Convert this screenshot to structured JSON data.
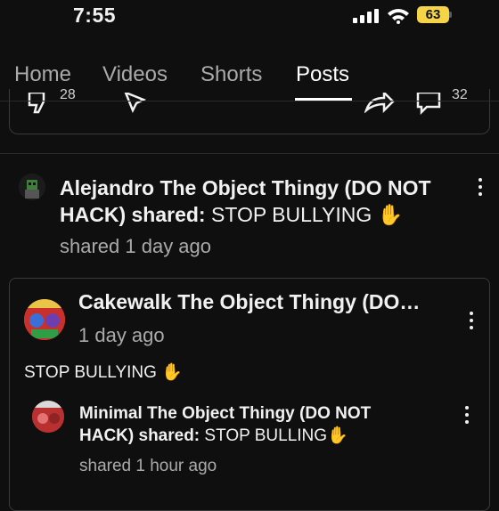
{
  "status_bar": {
    "time": "7:55",
    "battery": "63"
  },
  "tabs": [
    {
      "label": "Home",
      "active": false
    },
    {
      "label": "Videos",
      "active": false
    },
    {
      "label": "Shorts",
      "active": false
    },
    {
      "label": "Posts",
      "active": true
    }
  ],
  "previous_post": {
    "like_count": "28",
    "comment_count": "32"
  },
  "shared_post": {
    "author": "Alejandro The Object Thingy (DO NOT HACK)",
    "action": "shared:",
    "title": "STOP BULLYING ✋",
    "time": "shared 1 day ago"
  },
  "original_post": {
    "channel_name": "Cakewalk The Object Thingy (DO…",
    "time": "1 day ago",
    "text": "STOP BULLYING ✋",
    "nested": {
      "author": "Minimal The Object Thingy (DO NOT HACK)",
      "action": "shared:",
      "title": "STOP BULLING✋",
      "time": "shared 1 hour ago"
    }
  },
  "colors": {
    "background": "#0f0f0f",
    "battery": "#f5d547",
    "secondary_text": "#aaaaaa"
  },
  "icons": [
    "signal-icon",
    "wifi-icon",
    "dislike-icon",
    "share-icon",
    "comment-icon",
    "more-vert-icon"
  ]
}
